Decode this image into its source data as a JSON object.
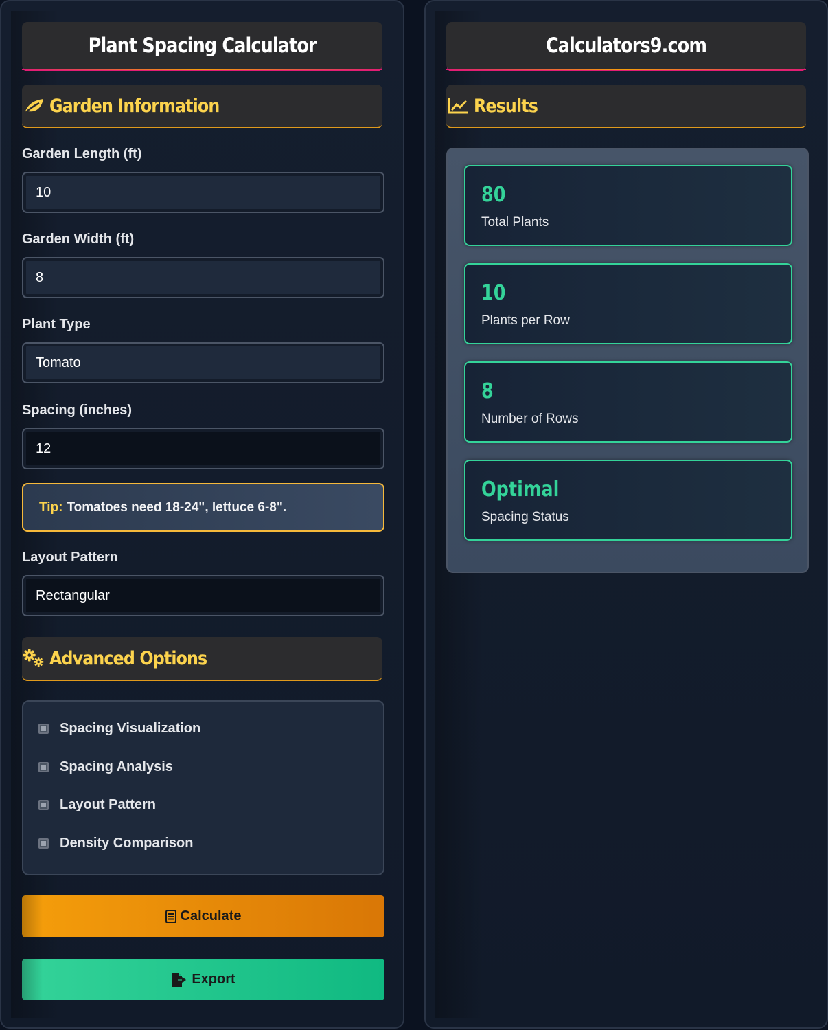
{
  "calculator": {
    "title": "Plant Spacing Calculator",
    "garden_section": "Garden Information",
    "fields": {
      "length": {
        "label": "Garden Length (ft)",
        "value": "10"
      },
      "width": {
        "label": "Garden Width (ft)",
        "value": "8"
      },
      "plant_type": {
        "label": "Plant Type",
        "value": "Tomato"
      },
      "spacing": {
        "label": "Spacing (inches)",
        "value": "12"
      },
      "layout": {
        "label": "Layout Pattern",
        "value": "Rectangular"
      }
    },
    "tip": {
      "key": "Tip:",
      "text": "Tomatoes need 18-24\", lettuce 6-8\"."
    },
    "advanced_section": "Advanced Options",
    "options": [
      "Spacing Visualization",
      "Spacing Analysis",
      "Layout Pattern",
      "Density Comparison"
    ],
    "buttons": {
      "calculate": "Calculate",
      "export": "Export"
    }
  },
  "site": {
    "title": "Calculators9.com",
    "results_section": "Results",
    "results": [
      {
        "value": "80",
        "label": "Total Plants"
      },
      {
        "value": "10",
        "label": "Plants per Row"
      },
      {
        "value": "8",
        "label": "Number of Rows"
      },
      {
        "value": "Optimal",
        "label": "Spacing Status"
      }
    ]
  },
  "icons": {
    "garden": "leaf-icon",
    "advanced": "gears-icon",
    "results": "chart-line-icon",
    "calculate": "calculator-icon",
    "export": "file-export-icon"
  },
  "colors": {
    "accent_yellow": "#fcd34d",
    "accent_green": "#34d399",
    "calculate_button": "#f59e0b",
    "export_button": "#10b981",
    "title_underline": "#e11d74"
  }
}
